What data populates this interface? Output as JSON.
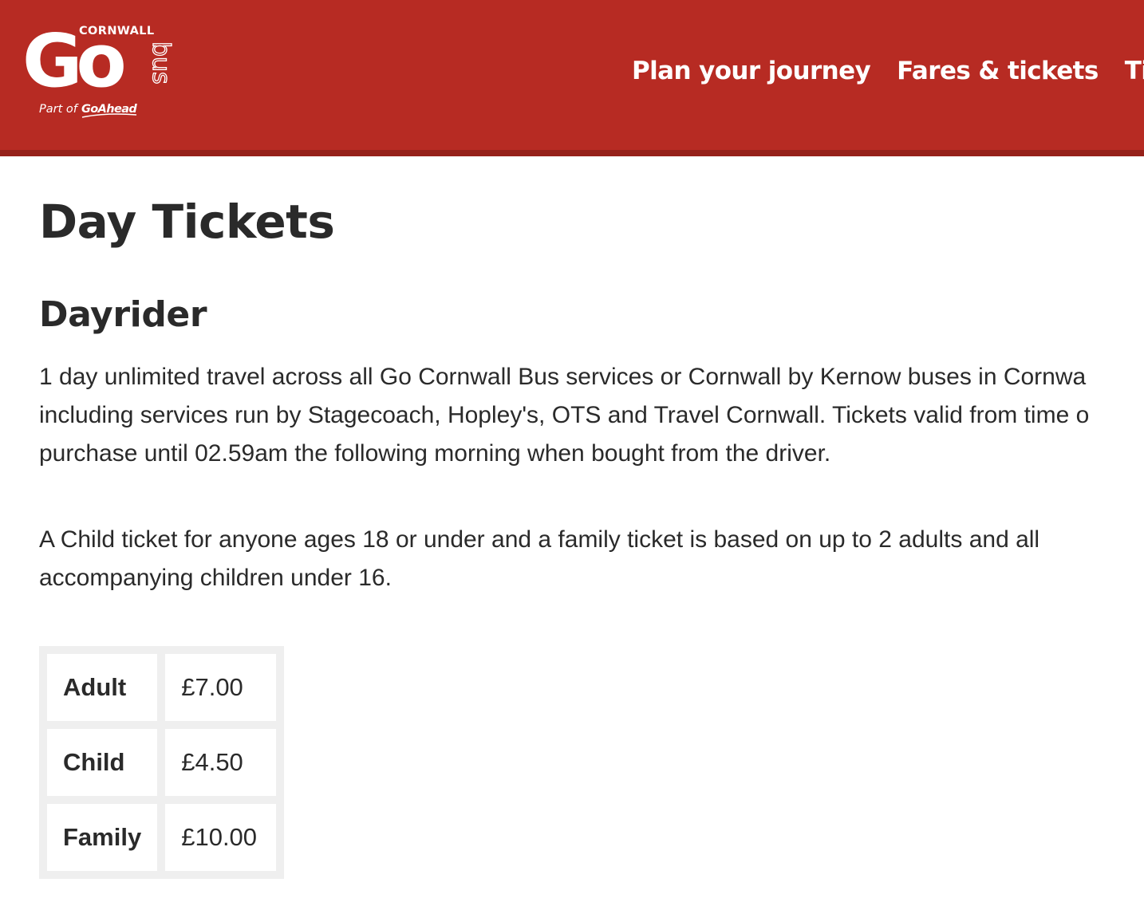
{
  "header": {
    "logo": {
      "wordmark": "Go",
      "region": "CORNWALL",
      "sub": "bus",
      "tagline_prefix": "Part of",
      "tagline_brand": "GoAhead"
    },
    "nav": [
      {
        "label": "Plan your journey"
      },
      {
        "label": "Fares & tickets"
      },
      {
        "label": "Tim"
      }
    ],
    "colors": {
      "brand_red": "#b72b23",
      "brand_red_dark": "#96211a"
    }
  },
  "main": {
    "title": "Day Tickets",
    "section": {
      "title": "Dayrider",
      "paragraph_1": [
        "1 day unlimited travel across all Go Cornwall Bus services or Cornwall by Kernow buses in Cornwa",
        "including services run by Stagecoach, Hopley's, OTS and Travel Cornwall. Tickets valid from time o",
        "purchase until 02.59am the following morning when bought from the driver."
      ],
      "paragraph_2": [
        "A Child ticket for anyone ages 18 or under and a family ticket is based on up to 2 adults and all",
        "accompanying children under 16."
      ]
    },
    "fares": [
      {
        "type": "Adult",
        "price": "£7.00"
      },
      {
        "type": "Child",
        "price": "£4.50"
      },
      {
        "type": "Family",
        "price": "£10.00"
      }
    ]
  }
}
